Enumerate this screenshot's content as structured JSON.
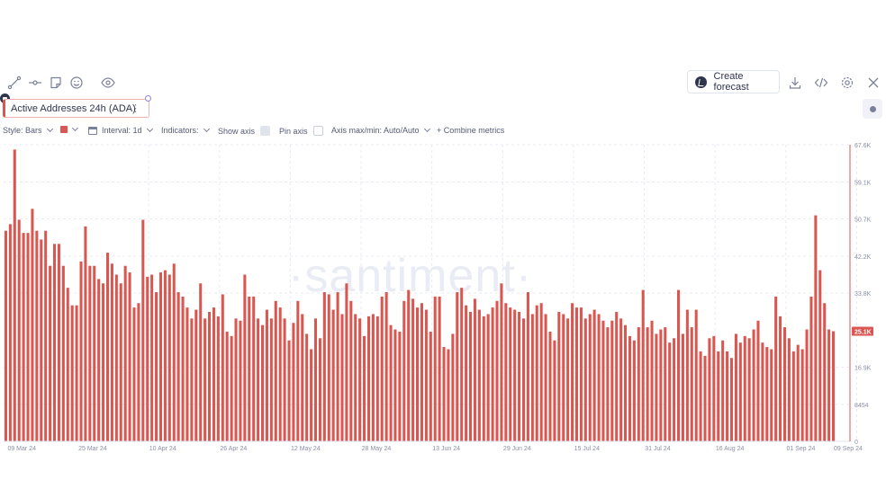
{
  "toolbar": {
    "tools": [
      "line-tool-icon",
      "horizontal-ray-icon",
      "note-icon",
      "emoji-icon",
      "eye-icon"
    ],
    "create_forecast_label": "Create forecast"
  },
  "metric_chip": {
    "label": "Active Addresses 24h (ADA)"
  },
  "settings": {
    "style_label": "Style: Bars",
    "interval_label": "Interval: 1d",
    "indicators_label": "Indicators:",
    "show_axis_label": "Show axis",
    "pin_axis_label": "Pin axis",
    "axis_maxmin_label": "Axis max/min: Auto/Auto",
    "combine_label": "+  Combine metrics"
  },
  "watermark": "·santiment·",
  "colors": {
    "bar": "#d95750",
    "axis_badge": "#d95750",
    "grid": "#e8ebf1"
  },
  "chart_data": {
    "type": "bar",
    "title": "Active Addresses 24h (ADA)",
    "xlabel": "",
    "ylabel": "",
    "ylim": [
      0,
      67600
    ],
    "y_ticks": [
      {
        "value": 67600,
        "label": "67.6K"
      },
      {
        "value": 59100,
        "label": "59.1K"
      },
      {
        "value": 50700,
        "label": "50.7K"
      },
      {
        "value": 42200,
        "label": "42.2K"
      },
      {
        "value": 33800,
        "label": "33.8K"
      },
      {
        "value": 16900,
        "label": "16.9K"
      },
      {
        "value": 8450,
        "label": "8454"
      },
      {
        "value": 0,
        "label": "0"
      }
    ],
    "x_tick_labels": [
      {
        "index": 0,
        "label": "09 Mar 24"
      },
      {
        "index": 16,
        "label": "25 Mar 24"
      },
      {
        "index": 32,
        "label": "10 Apr 24"
      },
      {
        "index": 48,
        "label": "26 Apr 24"
      },
      {
        "index": 64,
        "label": "12 May 24"
      },
      {
        "index": 80,
        "label": "28 May 24"
      },
      {
        "index": 96,
        "label": "13 Jun 24"
      },
      {
        "index": 112,
        "label": "29 Jun 24"
      },
      {
        "index": 128,
        "label": "15 Jul 24"
      },
      {
        "index": 144,
        "label": "31 Jul 24"
      },
      {
        "index": 160,
        "label": "16 Aug 24"
      },
      {
        "index": 176,
        "label": "01 Sep 24"
      },
      {
        "index": 184,
        "label": "09 Sep 24"
      }
    ],
    "current_value_label": "25.1K",
    "current_value": 25100,
    "start_date": "2024-03-08",
    "values": [
      48000,
      49500,
      66500,
      50500,
      47500,
      47500,
      53000,
      48000,
      46000,
      48000,
      40000,
      45000,
      45000,
      40000,
      35000,
      31000,
      31000,
      41000,
      49000,
      40000,
      40000,
      37000,
      36000,
      43000,
      40500,
      38000,
      36000,
      40000,
      38500,
      30500,
      31500,
      50500,
      37500,
      38000,
      34000,
      38500,
      39000,
      38000,
      40500,
      34000,
      33000,
      30500,
      28000,
      30000,
      36000,
      28000,
      29500,
      30500,
      28500,
      33500,
      25000,
      24000,
      28000,
      27500,
      38000,
      33000,
      33000,
      28000,
      26500,
      30000,
      28000,
      32000,
      30500,
      28000,
      23000,
      27000,
      32000,
      29000,
      24500,
      21000,
      28000,
      23500,
      34000,
      33500,
      30000,
      34000,
      29000,
      36000,
      32000,
      29000,
      28000,
      24000,
      28500,
      29000,
      28500,
      33000,
      34000,
      26500,
      25500,
      25000,
      32000,
      34500,
      32500,
      30500,
      31500,
      30000,
      25000,
      33000,
      33000,
      21500,
      21000,
      24500,
      34000,
      35000,
      31000,
      29500,
      32500,
      30000,
      28500,
      29000,
      30500,
      32000,
      36000,
      31500,
      30500,
      30000,
      29500,
      28000,
      34000,
      29000,
      31000,
      31500,
      29000,
      25000,
      23000,
      29500,
      29000,
      28000,
      31500,
      30500,
      30500,
      28000,
      29000,
      30000,
      29000,
      27500,
      26000,
      27500,
      29500,
      28000,
      26500,
      24000,
      23000,
      26000,
      34500,
      26000,
      27500,
      24500,
      25500,
      26000,
      22500,
      23500,
      34500,
      24500,
      30000,
      26000,
      30000,
      20500,
      19500,
      23500,
      24000,
      20500,
      23000,
      20500,
      19000,
      24500,
      22500,
      24000,
      23500,
      25500,
      27500,
      22500,
      21500,
      21000,
      33000,
      28500,
      26000,
      23500,
      20500,
      22000,
      21000,
      25500,
      33000,
      51500,
      39000,
      31500,
      25500,
      25100
    ]
  }
}
